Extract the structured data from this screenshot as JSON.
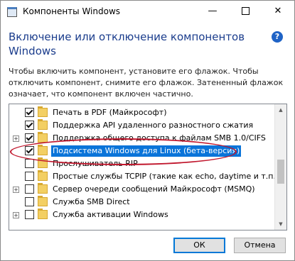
{
  "window": {
    "title": "Компоненты Windows",
    "minimize_glyph": "—",
    "close_glyph": "✕",
    "app_icon": "windows-features-icon"
  },
  "header": {
    "heading": "Включение или отключение компонентов Windows",
    "help_glyph": "?"
  },
  "description": "Чтобы включить компонент, установите его флажок. Чтобы отключить компонент, снимите его флажок. Затененный флажок означает, что компонент включен частично.",
  "features": [
    {
      "label": "Печать в PDF (Майкрософт)",
      "checked": true,
      "expandable": false,
      "selected": false
    },
    {
      "label": "Поддержка API удаленного разностного сжатия",
      "checked": true,
      "expandable": false,
      "selected": false
    },
    {
      "label": "Поддержка общего доступа к файлам SMB 1.0/CIFS",
      "checked": true,
      "expandable": true,
      "selected": false
    },
    {
      "label": "Подсистема Windows для Linux (бета-версия)",
      "checked": true,
      "expandable": false,
      "selected": true
    },
    {
      "label": "Прослушиватель RIP",
      "checked": false,
      "expandable": false,
      "selected": false
    },
    {
      "label": "Простые службы TCPIP (такие как echo, daytime и т.п.)",
      "checked": false,
      "expandable": false,
      "selected": false
    },
    {
      "label": "Сервер очереди сообщений Майкрософт (MSMQ)",
      "checked": false,
      "expandable": true,
      "selected": false
    },
    {
      "label": "Служба SMB Direct",
      "checked": false,
      "expandable": false,
      "selected": false
    },
    {
      "label": "Служба активации Windows",
      "checked": false,
      "expandable": true,
      "selected": false
    }
  ],
  "scrollbar": {
    "up_glyph": "▲",
    "down_glyph": "▼"
  },
  "buttons": {
    "ok": "ОК",
    "cancel": "Отмена"
  },
  "annotation": {
    "color": "#c0162c"
  }
}
